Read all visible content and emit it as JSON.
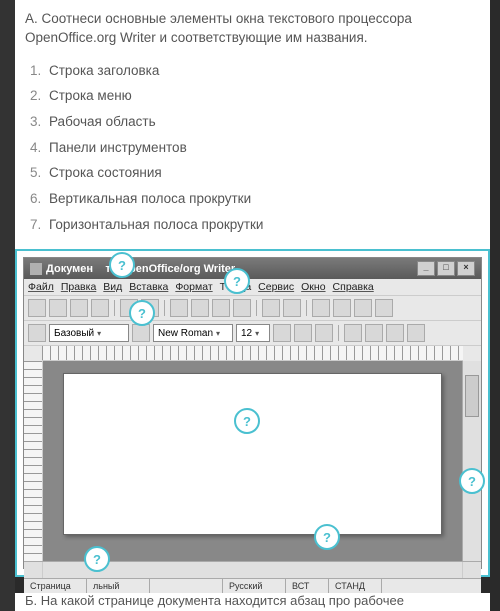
{
  "question": {
    "prefix": "А.",
    "text": "Соотнеси основные элементы окна текстового процессора OpenOffice.org Writer и соответствующие им названия.",
    "items": [
      "Строка заголовка",
      "Строка меню",
      "Рабочая область",
      "Панели инструментов",
      "Строка состояния",
      "Вертикальная полоса прокрутки",
      "Горизонтальная полоса прокрутки"
    ]
  },
  "app": {
    "title_prefix": "Докумен",
    "title_suffix": "т - OpenOffice/org Writer",
    "menu": {
      "file": "Файл",
      "edit": "Правка",
      "view": "Вид",
      "insert": "Вставка",
      "format": "Формат",
      "table_gap": "Т",
      "table_suffix": "ца",
      "service": "Сервис",
      "window": "Окно",
      "help": "Справка"
    },
    "style_combo": "Базовый",
    "font_combo": "New Roman",
    "size_combo": "12",
    "status": {
      "page": "Страница",
      "style": "льный",
      "lang": "Русский",
      "ins": "ВСТ",
      "std": "СТАНД"
    }
  },
  "marker_symbol": "?",
  "next_question": "Б. На какой странице документа находится абзац про рабочее"
}
